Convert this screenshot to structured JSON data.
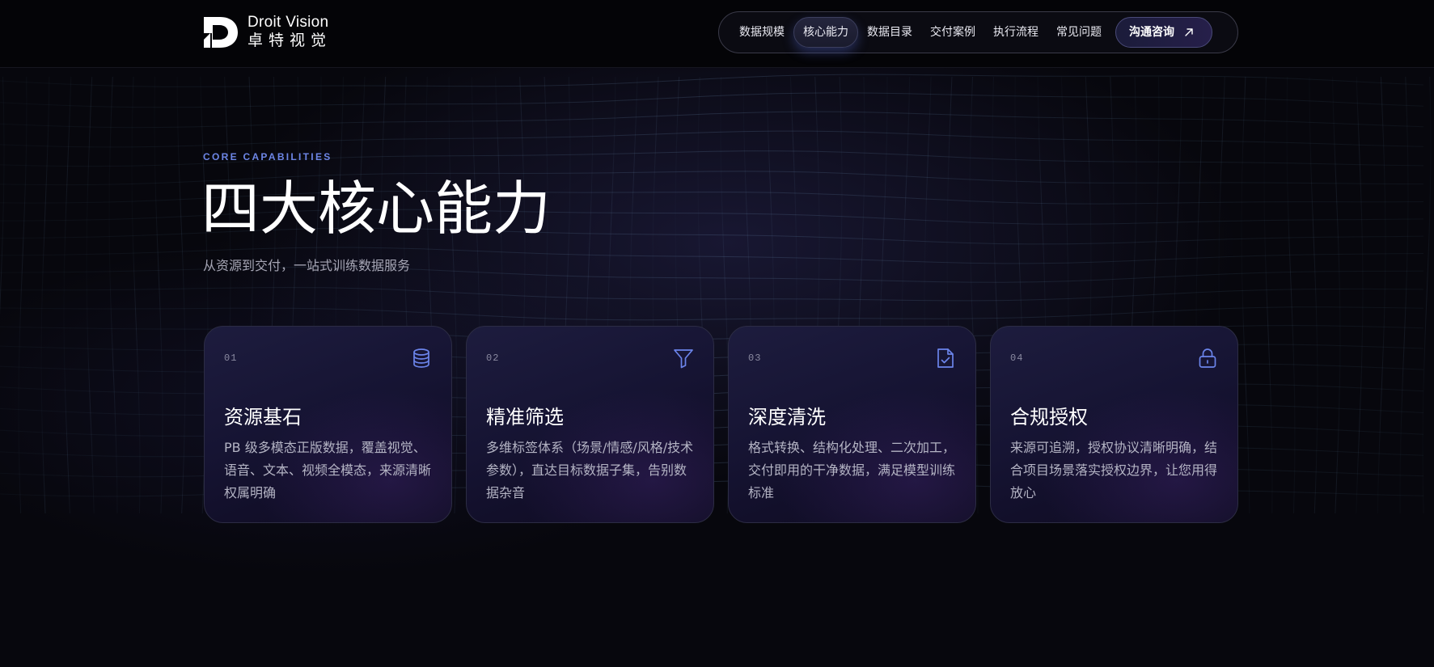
{
  "brand": {
    "name_en": "Droit Vision",
    "name_cn": "卓特视觉"
  },
  "nav": {
    "items": [
      {
        "label": "数据规模",
        "active": false
      },
      {
        "label": "核心能力",
        "active": true
      },
      {
        "label": "数据目录",
        "active": false
      },
      {
        "label": "交付案例",
        "active": false
      },
      {
        "label": "执行流程",
        "active": false
      },
      {
        "label": "常见问题",
        "active": false
      }
    ],
    "cta_label": "沟通咨询",
    "cta_icon": "arrow-up-right-icon"
  },
  "hero": {
    "eyebrow": "CORE CAPABILITIES",
    "title": "四大核心能力",
    "subtitle": "从资源到交付，一站式训练数据服务"
  },
  "cards": [
    {
      "num": "01",
      "title": "资源基石",
      "desc": "PB 级多模态正版数据，覆盖视觉、语音、文本、视频全模态，来源清晰权属明确",
      "icon": "database-icon"
    },
    {
      "num": "02",
      "title": "精准筛选",
      "desc": "多维标签体系（场景/情感/风格/技术参数），直达目标数据子集，告别数据杂音",
      "icon": "filter-icon"
    },
    {
      "num": "03",
      "title": "深度清洗",
      "desc": "格式转换、结构化处理、二次加工，交付即用的干净数据，满足模型训练标准",
      "icon": "file-check-icon"
    },
    {
      "num": "04",
      "title": "合规授权",
      "desc": "来源可追溯，授权协议清晰明确，结合项目场景落实授权边界，让您用得放心",
      "icon": "lock-icon"
    }
  ],
  "colors": {
    "accent": "#6d86e6",
    "icon": "#6b84ea",
    "background": "#07070d"
  }
}
